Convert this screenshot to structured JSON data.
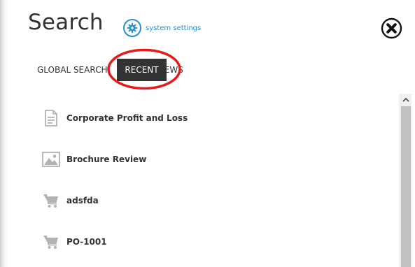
{
  "header": {
    "title": "Search",
    "settings_label": "system settings"
  },
  "tabs": [
    {
      "label": "GLOBAL SEARCH",
      "active": false
    },
    {
      "label": "RECENT",
      "active": true
    },
    {
      "label": "VIEWS",
      "active": false
    }
  ],
  "recent_items": [
    {
      "label": "Corporate Profit and Loss",
      "icon": "document-icon"
    },
    {
      "label": "Brochure Review",
      "icon": "image-icon"
    },
    {
      "label": "adsfda",
      "icon": "cart-icon"
    },
    {
      "label": "PO-1001",
      "icon": "cart-icon"
    }
  ],
  "colors": {
    "accent": "#2a93c9",
    "active_tab_bg": "#333333",
    "highlight_ring": "#e8191a",
    "text": "#333333",
    "icon_gray": "#b3b3b3"
  }
}
